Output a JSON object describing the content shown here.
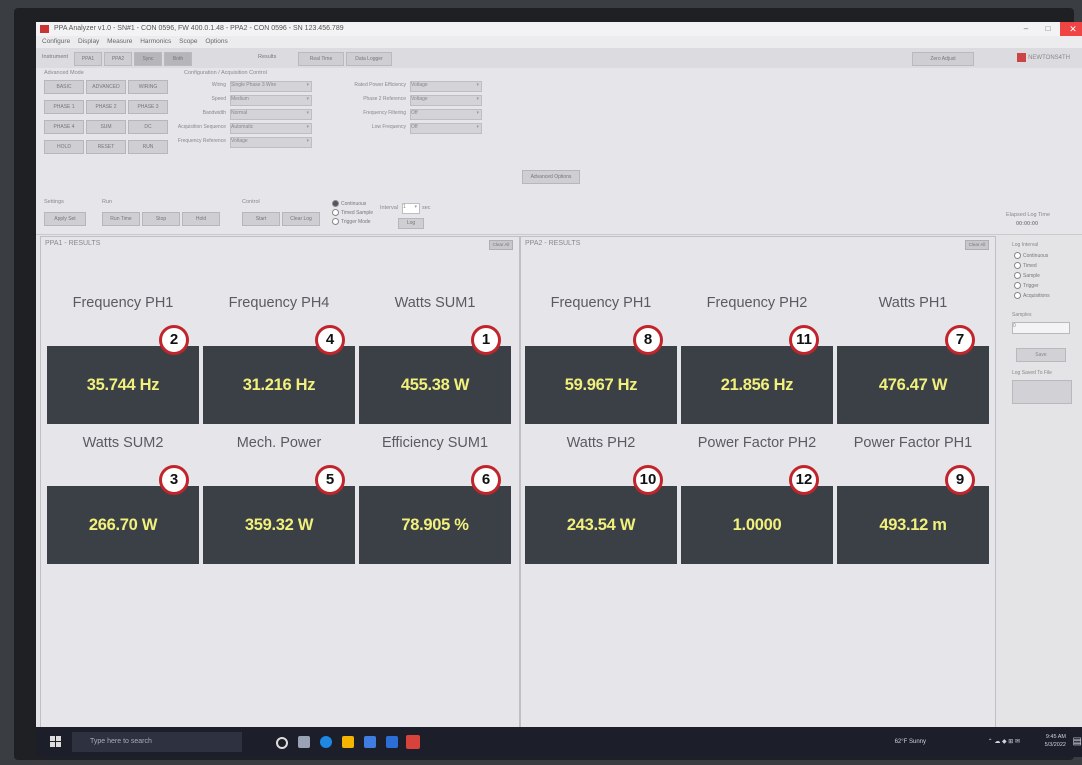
{
  "app": {
    "title": "PPA Analyzer v1.0 - SN#1 - CON 0596, FW 400.0.1.48 - PPA2 - CON 0596 - SN 123.456.789",
    "menu": [
      "Configure",
      "Display",
      "Measure",
      "Harmonics",
      "Scope",
      "Options"
    ],
    "brand": "NEWTONS4TH"
  },
  "toolbar": {
    "label": "Instrument",
    "buttons": [
      "PPA1",
      "PPA2",
      "Sync",
      "Both"
    ],
    "mode_label": "Results",
    "mode_buttons": [
      "Real Time",
      "Data Logger"
    ],
    "right_button": "Zero Adjust"
  },
  "settings": {
    "group_title": "Advanced Mode",
    "buttons": [
      "BASIC",
      "ADVANCED",
      "WIRING",
      "PHASE 1",
      "PHASE 2",
      "PHASE 3",
      "PHASE 4",
      "SUM",
      "DC",
      "HOLD",
      "RESET",
      "RUN"
    ],
    "config_title": "Configuration / Acquisition Control",
    "fields": [
      {
        "label": "Wiring",
        "value": "Single Phase 3 Wire"
      },
      {
        "label": "Speed",
        "value": "Medium"
      },
      {
        "label": "Bandwidth",
        "value": "Normal"
      },
      {
        "label": "Acquisition Sequence",
        "value": "Automatic"
      },
      {
        "label": "Frequency Reference",
        "value": "Voltage"
      }
    ],
    "fields2": [
      {
        "label": "Rated Power Efficiency",
        "value": "Voltage"
      },
      {
        "label": "Phase 2 Reference",
        "value": "Voltage"
      },
      {
        "label": "Frequency Filtering",
        "value": "Off"
      },
      {
        "label": "Low Frequency",
        "value": "Off"
      }
    ],
    "apply_button": "Advanced Options"
  },
  "control": {
    "settings_label": "Settings",
    "run_label": "Run",
    "control_label": "Control",
    "buttons": [
      "Apply Set",
      "Run Time",
      "Stop",
      "Hold",
      "Start",
      "Clear Log"
    ],
    "radios": [
      "Continuous",
      "Timed Sample",
      "Trigger Mode"
    ],
    "interval_label": "Interval",
    "interval_value": "1",
    "interval_unit": "sec",
    "log_button": "Log",
    "elapsed_label": "Elapsed Log Time",
    "elapsed_value": "00:00:00"
  },
  "panels": [
    {
      "title": "PPA1 - RESULTS",
      "button": "Clear All",
      "cells": [
        {
          "label": "Frequency PH1",
          "value": "35.744 Hz",
          "badge": "2"
        },
        {
          "label": "Frequency PH4",
          "value": "31.216 Hz",
          "badge": "4"
        },
        {
          "label": "Watts SUM1",
          "value": "455.38 W",
          "badge": "1"
        },
        {
          "label": "Watts SUM2",
          "value": "266.70 W",
          "badge": "3"
        },
        {
          "label": "Mech. Power",
          "value": "359.32 W",
          "badge": "5"
        },
        {
          "label": "Efficiency SUM1",
          "value": "78.905 %",
          "badge": "6"
        }
      ]
    },
    {
      "title": "PPA2 - RESULTS",
      "button": "Clear All",
      "cells": [
        {
          "label": "Frequency PH1",
          "value": "59.967 Hz",
          "badge": "8"
        },
        {
          "label": "Frequency PH2",
          "value": "21.856 Hz",
          "badge": "11"
        },
        {
          "label": "Watts PH1",
          "value": "476.47 W",
          "badge": "7"
        },
        {
          "label": "Watts PH2",
          "value": "243.54 W",
          "badge": "10"
        },
        {
          "label": "Power Factor PH2",
          "value": "1.0000",
          "badge": "12"
        },
        {
          "label": "Power Factor PH1",
          "value": "493.12 m",
          "badge": "9"
        }
      ]
    }
  ],
  "side_panel": {
    "group": "Log Interval",
    "options": [
      "Continuous",
      "Timed",
      "Sample",
      "Trigger",
      "Acquisitions"
    ],
    "field_label": "Samples",
    "field_value": "0",
    "button": "Save",
    "status_label": "Log Saved To File"
  },
  "taskbar": {
    "search_placeholder": "Type here to search",
    "weather": "62°F Sunny",
    "time": "9:45 AM",
    "date": "5/3/2022"
  }
}
